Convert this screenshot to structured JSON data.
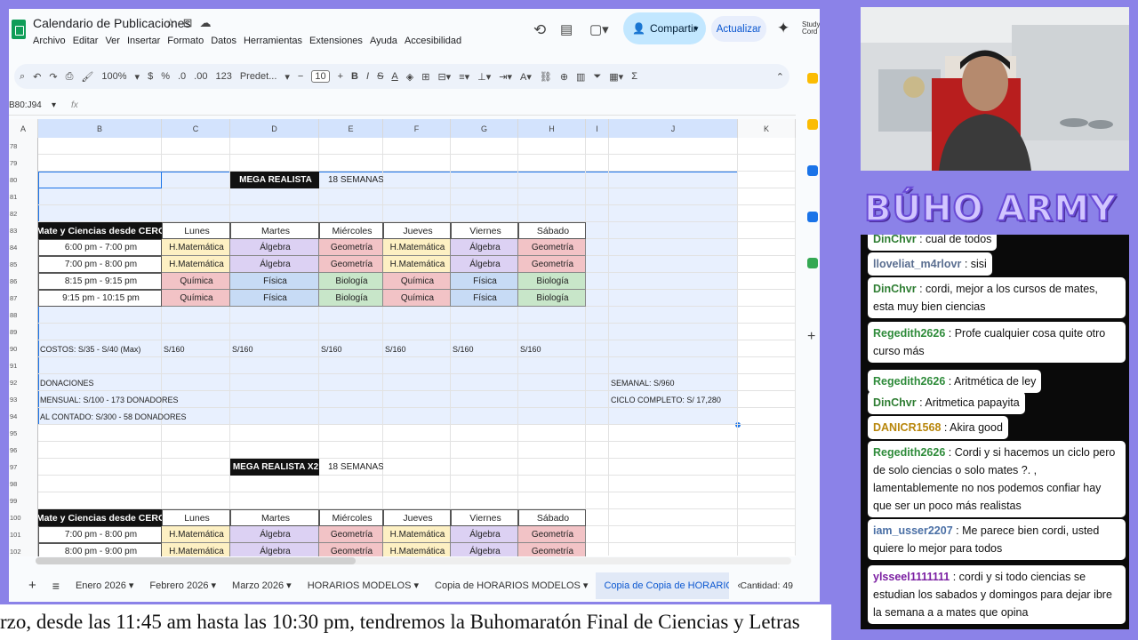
{
  "app": {
    "title": "Calendario de Publicaciones",
    "menu": [
      "Archivo",
      "Editar",
      "Ver",
      "Insertar",
      "Formato",
      "Datos",
      "Herramientas",
      "Extensiones",
      "Ayuda",
      "Accesibilidad"
    ],
    "share_label": "Compartir",
    "update_label": "Actualizar",
    "studio_label": "Study Cord"
  },
  "toolbar": {
    "zoom": "100%",
    "currency": "$",
    "percent": "%",
    "dec_less": ".0",
    "dec_more": ".00",
    "num_fmt": "123",
    "font": "Predet...",
    "font_size": "10"
  },
  "formula_bar": {
    "name_box": "B80:J94",
    "fx": "fx"
  },
  "columns": [
    "A",
    "B",
    "C",
    "D",
    "E",
    "F",
    "G",
    "H",
    "I",
    "J",
    "K"
  ],
  "rows": [
    "78",
    "79",
    "80",
    "81",
    "82",
    "83",
    "84",
    "85",
    "86",
    "87",
    "88",
    "89",
    "90",
    "91",
    "92",
    "93",
    "94",
    "95",
    "96",
    "97",
    "98",
    "99",
    "100",
    "101",
    "102"
  ],
  "block1": {
    "title": "MEGA REALISTA",
    "weeks": "18 SEMANAS",
    "header": [
      "Mate y Ciencias desde CERO",
      "Lunes",
      "Martes",
      "Miércoles",
      "Jueves",
      "Viernes",
      "Sábado"
    ],
    "rows": [
      [
        "6:00 pm - 7:00 pm",
        "H.Matemática",
        "Álgebra",
        "Geometría",
        "H.Matemática",
        "Álgebra",
        "Geometría"
      ],
      [
        "7:00 pm - 8:00 pm",
        "H.Matemática",
        "Álgebra",
        "Geometría",
        "H.Matemática",
        "Álgebra",
        "Geometría"
      ],
      [
        "8:15 pm - 9:15 pm",
        "Química",
        "Física",
        "Biología",
        "Química",
        "Física",
        "Biología"
      ],
      [
        "9:15 pm - 10:15 pm",
        "Química",
        "Física",
        "Biología",
        "Química",
        "Física",
        "Biología"
      ]
    ],
    "costs": [
      "COSTOS: S/35 - S/40 (Max)",
      "S/160",
      "S/160",
      "S/160",
      "S/160",
      "S/160",
      "S/160"
    ],
    "donations": "DONACIONES",
    "monthly": "MENSUAL: S/100 -  173 DONADORES",
    "cash": "AL CONTADO: S/300 -  58 DONADORES",
    "weekly": "SEMANAL: S/960",
    "full_cycle": "CICLO COMPLETO: S/ 17,280"
  },
  "block2": {
    "title": "MEGA REALISTA X2",
    "weeks": "18 SEMANAS",
    "header": [
      "Mate y Ciencias desde CERO",
      "Lunes",
      "Martes",
      "Miércoles",
      "Jueves",
      "Viernes",
      "Sábado"
    ],
    "rows": [
      [
        "7:00 pm - 8:00 pm",
        "H.Matemática",
        "Álgebra",
        "Geometría",
        "H.Matemática",
        "Álgebra",
        "Geometría"
      ],
      [
        "8:00 pm - 9:00 pm",
        "H.Matemática",
        "Álgebra",
        "Geometría",
        "H.Matemática",
        "Álgebra",
        "Geometría"
      ]
    ]
  },
  "sheet_tabs": [
    "Enero 2026",
    "Febrero 2026",
    "Marzo 2026",
    "HORARIOS MODELOS",
    "Copia de HORARIOS MODELOS",
    "Copia de Copia de HORARIOS MO"
  ],
  "status": {
    "count": "Cantidad: 49"
  },
  "brand": "BÚHO ARMY",
  "chat": [
    {
      "user": "DinChvr",
      "text": "cual de todos",
      "color": "#2e7d32"
    },
    {
      "user": "lloveliat_m4rlovr",
      "text": "sisi",
      "color": "#5a6e90"
    },
    {
      "user": "DinChvr",
      "text": "cordi, mejor a los cursos de mates, esta muy bien ciencias",
      "color": "#2e7d32"
    },
    {
      "user": "Regedith2626",
      "text": "Profe cualquier cosa quite otro curso más",
      "color": "#2e8b3a"
    },
    {
      "user": "Regedith2626",
      "text": "Aritmética de ley",
      "color": "#2e8b3a"
    },
    {
      "user": "DinChvr",
      "text": "Aritmetica papayita",
      "color": "#2e7d32"
    },
    {
      "user": "DANICR1568",
      "text": "Akira good",
      "color": "#b8860b"
    },
    {
      "user": "Regedith2626",
      "text": "Cordi y si hacemos un ciclo pero de solo ciencias o solo mates ?. , lamentablemente no nos podemos confiar hay que ser un poco más realistas",
      "color": "#2e8b3a"
    },
    {
      "user": "iam_usser2207",
      "text": "Me parece bien cordi, usted quiere lo mejor para todos",
      "color": "#4a6fa5"
    },
    {
      "user": "ylsseel1111111",
      "text": "cordi y si todo ciencias se estudian los sabados y domingos para dejar ibre la semana a a mates que opina",
      "color": "#7b1fa2"
    }
  ],
  "ticker": "rzo, desde las 11:45 am hasta las 10:30 pm, tendremos la Buhomaratón Final de Ciencias y Letras"
}
